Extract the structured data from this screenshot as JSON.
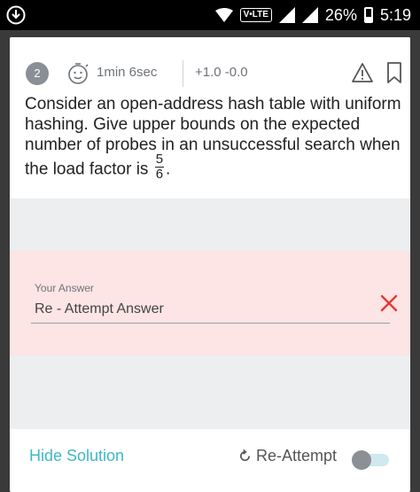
{
  "status_bar": {
    "network_badge": "V•LTE",
    "battery": "26%",
    "time": "5:19",
    "icons": [
      "download-icon",
      "wifi-icon",
      "signal-icon",
      "signal-icon",
      "battery-icon"
    ]
  },
  "question": {
    "number": "2",
    "time_taken": "1min 6sec",
    "marks": "+1.0  -0.0",
    "text": "Consider an open-address hash table with uniform hashing. Give upper bounds on the expected number of probes in an unsuccessful search when the load factor is",
    "fraction": {
      "numerator": "5",
      "denominator": "6"
    },
    "text_end": "."
  },
  "answer": {
    "label": "Your Answer",
    "value": "Re - Attempt Answer",
    "status": "wrong"
  },
  "actions": {
    "hide_solution": "Hide Solution",
    "reattempt": "Re-Attempt",
    "toggle_on": false
  },
  "colors": {
    "accent": "#3fb8c4",
    "wrong": "#e53935",
    "answer_bg": "#fde4e5"
  }
}
